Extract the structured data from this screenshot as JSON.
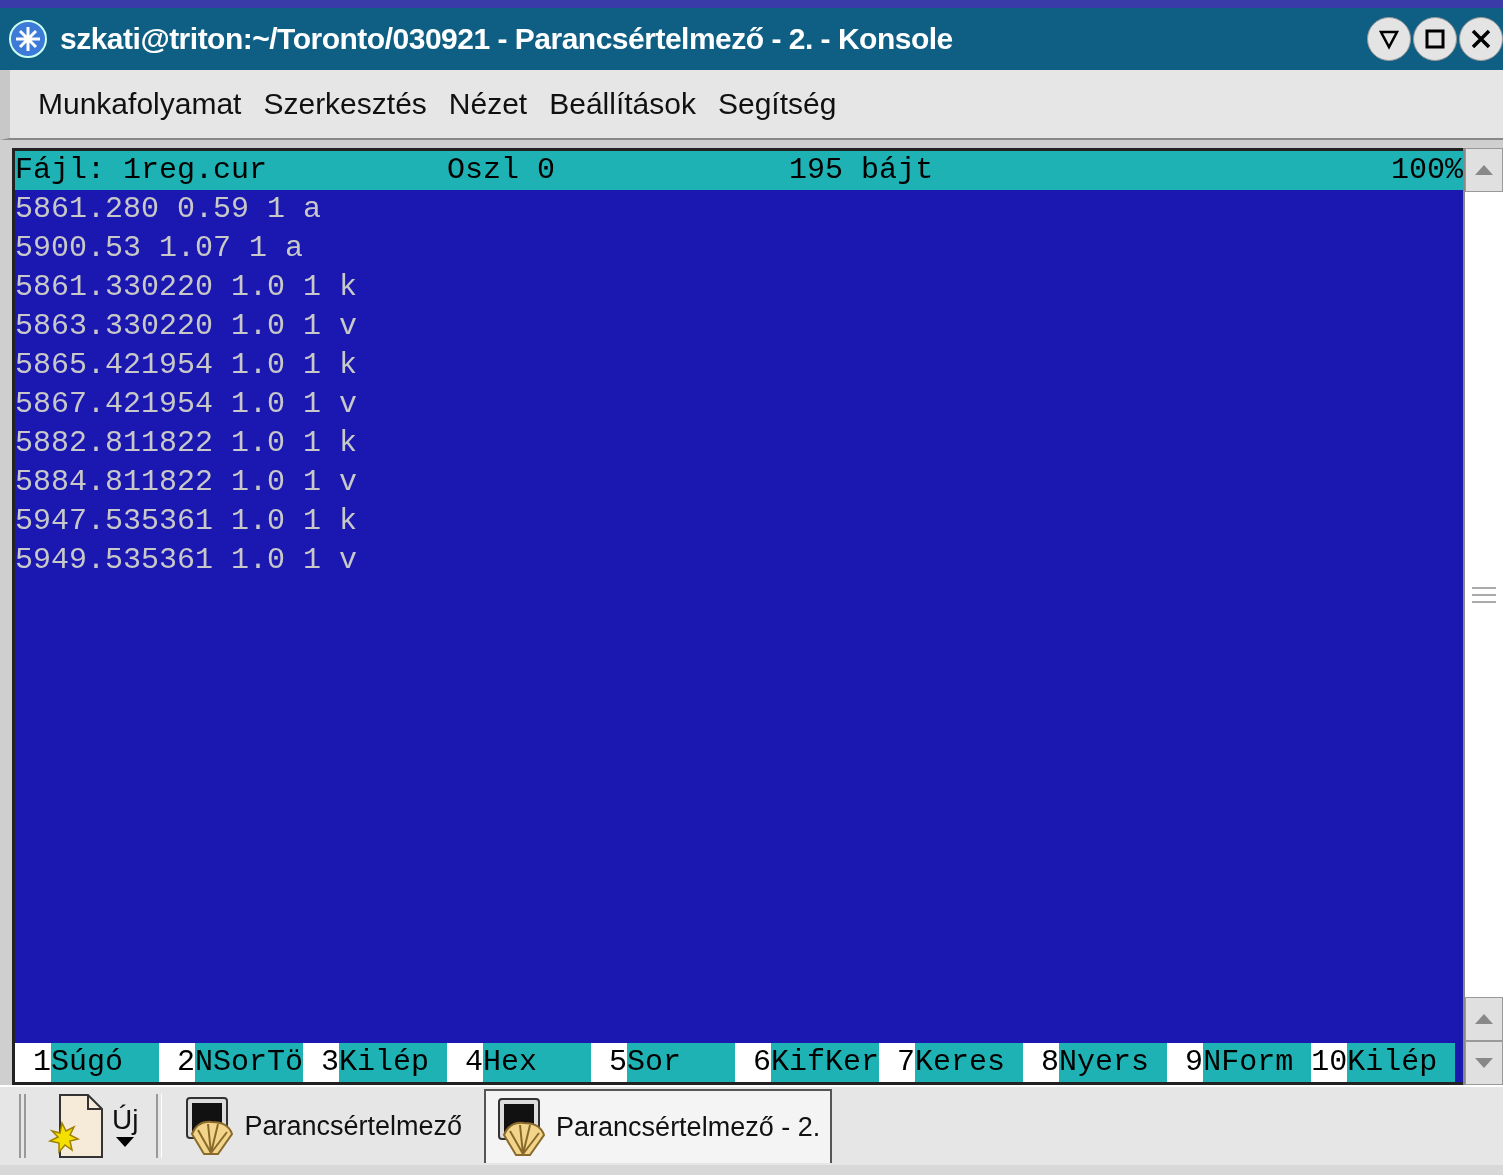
{
  "window": {
    "title": "szkati@triton:~/Toronto/030921 - Parancsértelmező - 2. - Konsole"
  },
  "menu": [
    "Munkafolyamat",
    "Szerkesztés",
    "Nézet",
    "Beállítások",
    "Segítség"
  ],
  "terminal": {
    "status": {
      "file": "Fájl: 1reg.cur",
      "column": "Oszl 0",
      "size": "195 bájt",
      "percent": "100%"
    },
    "lines": [
      "5861.280 0.59 1 a",
      "5900.53 1.07 1 a",
      "5861.330220 1.0 1 k",
      "5863.330220 1.0 1 v",
      "5865.421954 1.0 1 k",
      "5867.421954 1.0 1 v",
      "5882.811822 1.0 1 k",
      "5884.811822 1.0 1 v",
      "5947.535361 1.0 1 k",
      "5949.535361 1.0 1 v"
    ],
    "function_keys": [
      {
        "number": "1",
        "label": "Súgó"
      },
      {
        "number": "2",
        "label": "NSorTö"
      },
      {
        "number": "3",
        "label": "Kilép"
      },
      {
        "number": "4",
        "label": "Hex"
      },
      {
        "number": "5",
        "label": "Sor"
      },
      {
        "number": "6",
        "label": "KifKer"
      },
      {
        "number": "7",
        "label": "Keres"
      },
      {
        "number": "8",
        "label": "Nyers"
      },
      {
        "number": "9",
        "label": "NForm"
      },
      {
        "number": "10",
        "label": "Kilép"
      }
    ]
  },
  "taskbar": {
    "new_button": "Új",
    "tasks": [
      {
        "label": "Parancsértelmező",
        "selected": false
      },
      {
        "label": "Parancsértelmező - 2.",
        "selected": true
      }
    ]
  }
}
